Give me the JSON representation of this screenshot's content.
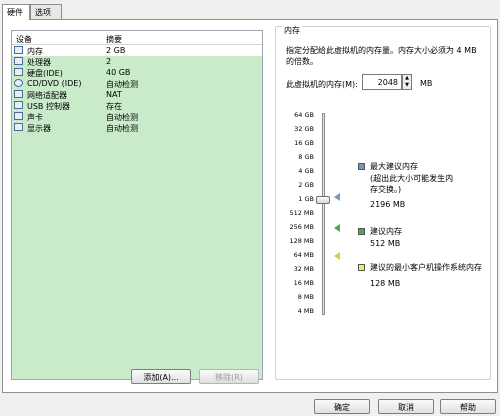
{
  "tabs": [
    "硬件",
    "选项"
  ],
  "device_list": {
    "headers": {
      "device": "设备",
      "summary": "摘要"
    },
    "rows": [
      {
        "name": "内存",
        "value": "2 GB",
        "icon": "memory-icon"
      },
      {
        "name": "处理器",
        "value": "2",
        "icon": "processor-icon"
      },
      {
        "name": "硬盘(IDE)",
        "value": "40 GB",
        "icon": "hard-disk-icon"
      },
      {
        "name": "CD/DVD (IDE)",
        "value": "自动检测",
        "icon": "cd-dvd-icon"
      },
      {
        "name": "网络适配器",
        "value": "NAT",
        "icon": "network-adapter-icon"
      },
      {
        "name": "USB 控制器",
        "value": "存在",
        "icon": "usb-icon"
      },
      {
        "name": "声卡",
        "value": "自动检测",
        "icon": "sound-card-icon"
      },
      {
        "name": "显示器",
        "value": "自动检测",
        "icon": "display-icon"
      }
    ],
    "add_button": "添加(A)...",
    "remove_button": "移除(R)"
  },
  "memory": {
    "group_title": "内存",
    "description": "指定分配给此虚拟机的内存量。内存大小必须为 4 MB 的倍数。",
    "field_label": "此虚拟机的内存(M):",
    "value": "2048",
    "unit": "MB",
    "scale": [
      "64 GB",
      "32 GB",
      "16 GB",
      "8 GB",
      "4 GB",
      "2 GB",
      "1 GB",
      "512 MB",
      "256 MB",
      "128 MB",
      "64 MB",
      "32 MB",
      "16 MB",
      "8 MB",
      "4 MB"
    ],
    "legend": {
      "max_recommended": "最大建议内存",
      "max_note": "(超出此大小可能发生内存交换。)",
      "max_value": "2196 MB",
      "recommended": "建议内存",
      "recommended_value": "512 MB",
      "min_recommended": "建议的最小客户机操作系统内存",
      "min_value": "128 MB"
    }
  },
  "footer": {
    "ok": "确定",
    "cancel": "取消",
    "help": "帮助"
  },
  "colors": {
    "list_bg": "#c9ebc9",
    "max_marker": "#7896b9",
    "rec_marker": "#4eaa4e",
    "min_marker": "#d9d030"
  }
}
